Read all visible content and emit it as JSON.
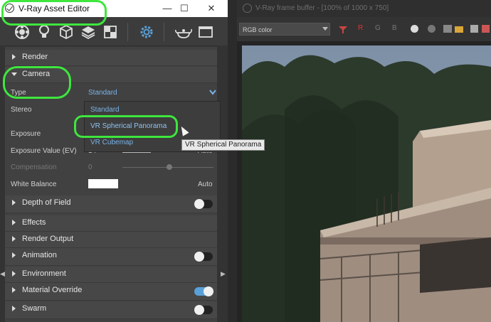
{
  "asset_editor": {
    "title": "V-Ray Asset Editor",
    "window_controls": {
      "minimize": "—",
      "maximize": "☐",
      "close": "✕"
    },
    "toolbar_icons": [
      "materials-icon",
      "lights-icon",
      "geometry-icon",
      "layers-icon",
      "textures-icon",
      "settings-icon",
      "render-teapot-icon",
      "frame-buffer-icon"
    ],
    "sections": {
      "render": "Render",
      "camera": "Camera",
      "depth_of_field": "Depth of Field",
      "effects": "Effects",
      "render_output": "Render Output",
      "animation": "Animation",
      "environment": "Environment",
      "material_override": "Material Override",
      "swarm": "Swarm"
    },
    "camera": {
      "type_label": "Type",
      "type_value": "Standard",
      "stereo_label": "Stereo",
      "exposure_label": "Exposure",
      "exposure_value_label": "Exposure Value (EV)",
      "exposure_value": "14",
      "exposure_auto": "Auto",
      "compensation_label": "Compensation",
      "compensation_value": "0",
      "white_balance_label": "White Balance",
      "white_balance_auto": "Auto"
    },
    "dropdown_options": [
      "Standard",
      "VR Spherical Panorama",
      "VR Cubemap"
    ],
    "tooltip": "VR Spherical Panorama",
    "toggles": {
      "depth_of_field": false,
      "animation": false,
      "material_override": true,
      "swarm": false
    },
    "accent_color": "#7ab3e8",
    "annotation_color": "#3ee63e"
  },
  "frame_buffer": {
    "title": "V-Ray frame buffer - [100% of 1000 x 750]",
    "channel_select": "RGB color",
    "channel_buttons": [
      "R",
      "G",
      "B"
    ]
  }
}
